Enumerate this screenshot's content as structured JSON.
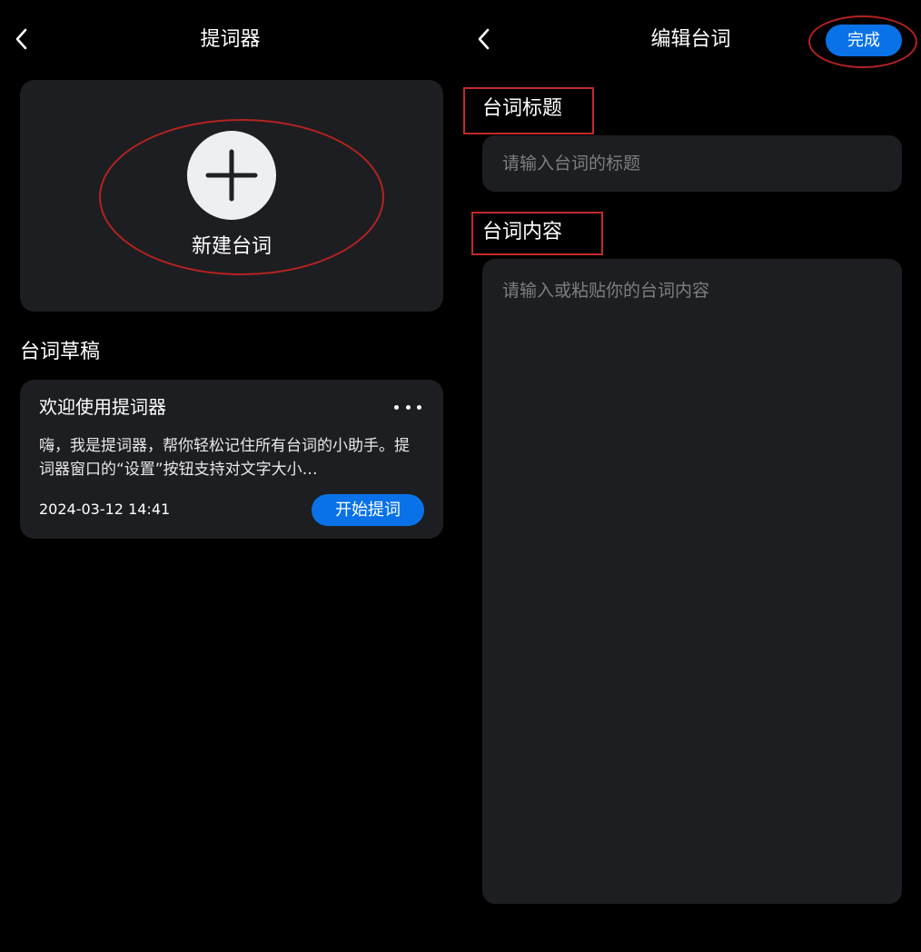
{
  "left_screen": {
    "title": "提词器",
    "new_script_label": "新建台词",
    "drafts_heading": "台词草稿",
    "draft": {
      "title": "欢迎使用提词器",
      "body": "嗨，我是提词器，帮你轻松记住所有台词的小助手。提词器窗口的“设置”按钮支持对文字大小…",
      "date": "2024-03-12 14:41",
      "start_label": "开始提词"
    }
  },
  "right_screen": {
    "title": "编辑台词",
    "done_label": "完成",
    "title_field": {
      "label": "台词标题",
      "placeholder": "请输入台词的标题"
    },
    "content_field": {
      "label": "台词内容",
      "placeholder": "请输入或粘贴你的台词内容"
    }
  },
  "icons": {
    "back": "chevron-left-icon",
    "add": "plus-icon",
    "more": "more-horizontal-icon"
  },
  "colors": {
    "background": "#000000",
    "card": "#1d1e21",
    "accent": "#0a72e8",
    "annotation": "#b42222",
    "placeholder": "#7d7e82"
  }
}
